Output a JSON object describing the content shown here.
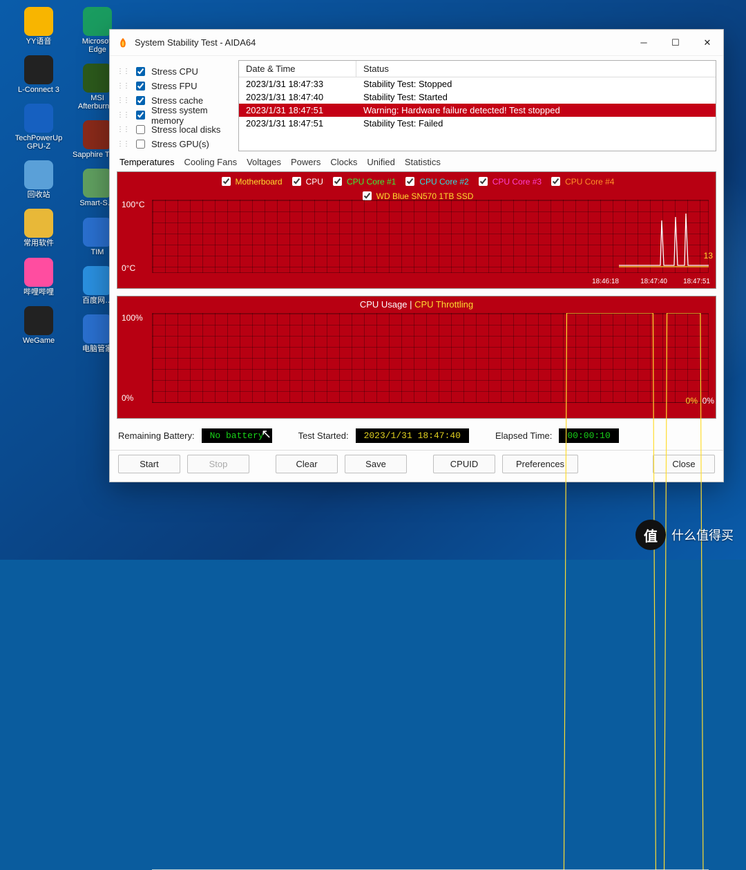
{
  "desktop_icons_col1": [
    {
      "label": "YY语音",
      "bg": "#f8b500"
    },
    {
      "label": "L-Connect 3",
      "bg": "#222"
    },
    {
      "label": "TechPowerUp GPU-Z",
      "bg": "#1660c0"
    },
    {
      "label": "回收站",
      "bg": "#5aa0d8"
    },
    {
      "label": "常用软件",
      "bg": "#e8b838"
    },
    {
      "label": "哔哩哔哩",
      "bg": "#ff4da0"
    },
    {
      "label": "WeGame",
      "bg": "#222"
    }
  ],
  "desktop_icons_col2": [
    {
      "label": "Microsoft Edge",
      "bg": "#1a9c60"
    },
    {
      "label": "MSI Afterburn…",
      "bg": "#2c5a1c"
    },
    {
      "label": "Sapphire TRIX",
      "bg": "#8a2a1a"
    },
    {
      "label": "Smart-S…",
      "bg": "#60a060"
    },
    {
      "label": "TIM",
      "bg": "#2a70d0"
    },
    {
      "label": "百度网…",
      "bg": "#2a90e0"
    },
    {
      "label": "电脑管家",
      "bg": "#2a70d0"
    }
  ],
  "window": {
    "title": "System Stability Test - AIDA64"
  },
  "stress_options": [
    {
      "label": "Stress CPU",
      "checked": true
    },
    {
      "label": "Stress FPU",
      "checked": true
    },
    {
      "label": "Stress cache",
      "checked": true
    },
    {
      "label": "Stress system memory",
      "checked": true
    },
    {
      "label": "Stress local disks",
      "checked": false
    },
    {
      "label": "Stress GPU(s)",
      "checked": false
    }
  ],
  "log": {
    "head1": "Date & Time",
    "head2": "Status",
    "rows": [
      {
        "t": "2023/1/31 18:47:33",
        "s": "Stability Test: Stopped",
        "warn": false
      },
      {
        "t": "2023/1/31 18:47:40",
        "s": "Stability Test: Started",
        "warn": false
      },
      {
        "t": "2023/1/31 18:47:51",
        "s": "Warning: Hardware failure detected! Test stopped",
        "warn": true
      },
      {
        "t": "2023/1/31 18:47:51",
        "s": "Stability Test: Failed",
        "warn": false
      }
    ]
  },
  "tabs": [
    "Temperatures",
    "Cooling Fans",
    "Voltages",
    "Powers",
    "Clocks",
    "Unified",
    "Statistics"
  ],
  "active_tab": "Temperatures",
  "temp_legend": [
    {
      "label": "Motherboard",
      "cls": "leg-y",
      "checked": true
    },
    {
      "label": "CPU",
      "cls": "leg-w",
      "checked": true
    },
    {
      "label": "CPU Core #1",
      "cls": "leg-g",
      "checked": true
    },
    {
      "label": "CPU Core #2",
      "cls": "leg-c",
      "checked": true
    },
    {
      "label": "CPU Core #3",
      "cls": "leg-m",
      "checked": true
    },
    {
      "label": "CPU Core #4",
      "cls": "leg-o",
      "checked": true
    }
  ],
  "temp_legend2": [
    {
      "label": "WD Blue SN570 1TB SSD",
      "cls": "leg-y",
      "checked": true
    }
  ],
  "chart_data": [
    {
      "type": "line",
      "title": "Temperatures",
      "ylabel": "°C",
      "ylim": [
        0,
        100
      ],
      "xticks": [
        "18:46:18",
        "18:47:40",
        "18:47:51"
      ],
      "series": [
        {
          "name": "Motherboard",
          "current": 13
        },
        {
          "name": "CPU"
        },
        {
          "name": "CPU Core #1"
        },
        {
          "name": "CPU Core #2"
        },
        {
          "name": "CPU Core #3"
        },
        {
          "name": "CPU Core #4"
        },
        {
          "name": "WD Blue SN570 1TB SSD"
        }
      ]
    },
    {
      "type": "line",
      "title": "CPU Usage | CPU Throttling",
      "ylabel": "%",
      "ylim": [
        0,
        100
      ],
      "x": [
        0,
        0.74,
        0.745,
        0.9,
        0.905,
        0.92,
        0.925,
        0.985,
        0.99,
        1.0
      ],
      "series": [
        {
          "name": "CPU Usage",
          "values": [
            0,
            0,
            100,
            100,
            0,
            0,
            100,
            100,
            0,
            0
          ],
          "current": 0
        },
        {
          "name": "CPU Throttling",
          "values": [
            0,
            0,
            0,
            0,
            0,
            0,
            0,
            0,
            0,
            0
          ],
          "current": 0
        }
      ]
    }
  ],
  "y_top": "100°C",
  "y_bot": "0°C",
  "y2_top": "100%",
  "y2_bot": "0%",
  "end_temp": "13",
  "xt": [
    "18:46:18",
    "18:47:40",
    "18:47:51"
  ],
  "usage_title_a": "CPU Usage",
  "usage_title_sep": "  |  ",
  "usage_title_b": "CPU Throttling",
  "end_usage1": "0%",
  "end_usage2": "0%",
  "status": {
    "battery_lbl": "Remaining Battery:",
    "battery_val": "No battery",
    "started_lbl": "Test Started:",
    "started_val": "2023/1/31 18:47:40",
    "elapsed_lbl": "Elapsed Time:",
    "elapsed_val": "00:00:10"
  },
  "buttons": {
    "start": "Start",
    "stop": "Stop",
    "clear": "Clear",
    "save": "Save",
    "cpuid": "CPUID",
    "prefs": "Preferences",
    "close": "Close"
  },
  "watermark": "什么值得买"
}
